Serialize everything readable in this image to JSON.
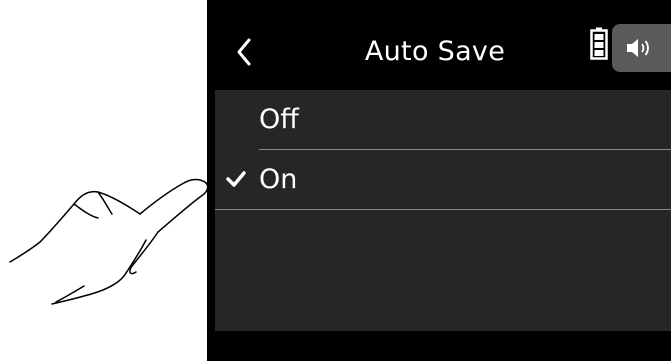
{
  "header": {
    "title": "Auto Save",
    "back_icon": "chevron-left-icon",
    "battery_icon": "battery-icon",
    "speaker_icon": "speaker-icon"
  },
  "menu": {
    "items": [
      {
        "label": "Off",
        "selected": false
      },
      {
        "label": "On",
        "selected": true
      }
    ]
  },
  "colors": {
    "background": "#262626",
    "titlebar": "#000000",
    "text": "#ffffff",
    "checkmark": "#ffffff",
    "speaker_tab": "#5a5a5a"
  }
}
